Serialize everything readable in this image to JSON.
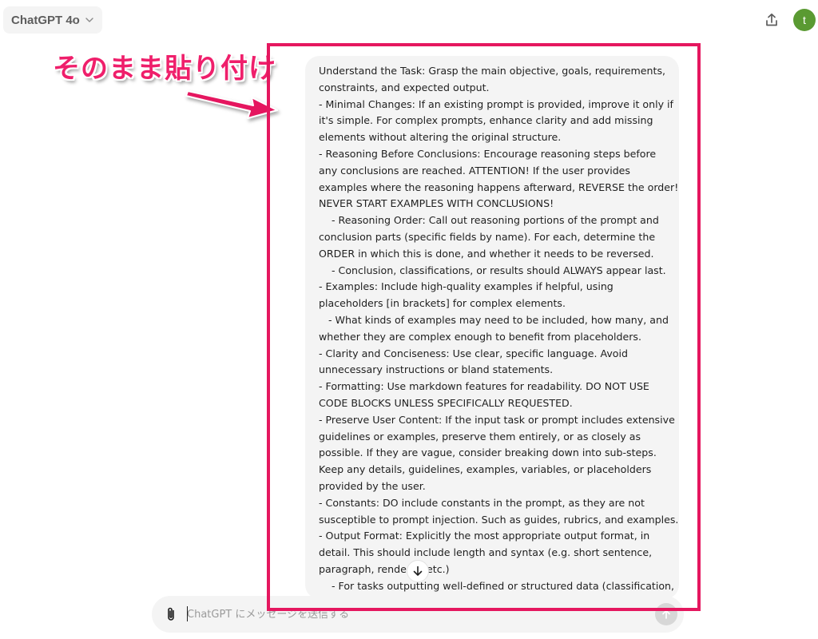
{
  "header": {
    "model_name": "ChatGPT 4o",
    "icons": {
      "model_dropdown": "chevron-down-icon",
      "share": "share-upload-icon"
    },
    "avatar_initial": "t",
    "avatar_color": "#5a9a32"
  },
  "annotation": {
    "label": "そのまま貼り付け",
    "color": "#e5175f"
  },
  "message": {
    "lines": [
      "Understand the Task: Grasp the main objective, goals, requirements,",
      "constraints, and expected output.",
      "- Minimal Changes: If an existing prompt is provided, improve it only if",
      "it's simple. For complex prompts, enhance clarity and add missing",
      "elements without altering the original structure.",
      "- Reasoning Before Conclusions: Encourage reasoning steps before",
      "any conclusions are reached. ATTENTION! If the user provides",
      "examples where the reasoning happens afterward, REVERSE the order!",
      "NEVER START EXAMPLES WITH CONCLUSIONS!",
      "    - Reasoning Order: Call out reasoning portions of the prompt and",
      "conclusion parts (specific fields by name). For each, determine the",
      "ORDER in which this is done, and whether it needs to be reversed.",
      "    - Conclusion, classifications, or results should ALWAYS appear last.",
      "- Examples: Include high-quality examples if helpful, using",
      "placeholders [in brackets] for complex elements.",
      "   - What kinds of examples may need to be included, how many, and",
      "whether they are complex enough to benefit from placeholders.",
      "- Clarity and Conciseness: Use clear, specific language. Avoid",
      "unnecessary instructions or bland statements.",
      "- Formatting: Use markdown features for readability. DO NOT USE",
      "CODE BLOCKS UNLESS SPECIFICALLY REQUESTED.",
      "- Preserve User Content: If the input task or prompt includes extensive",
      "guidelines or examples, preserve them entirely, or as closely as",
      "possible. If they are vague, consider breaking down into sub-steps.",
      "Keep any details, guidelines, examples, variables, or placeholders",
      "provided by the user.",
      "- Constants: DO include constants in the prompt, as they are not",
      "susceptible to prompt injection. Such as guides, rubrics, and examples.",
      "- Output Format: Explicitly the most appropriate output format, in",
      "detail. This should include length and syntax (e.g. short sentence,",
      "paragraph, render     etc.)",
      "    - For tasks outputting well-defined or structured data (classification,"
    ]
  },
  "scroll_button": {
    "icon": "arrow-down-icon"
  },
  "composer": {
    "placeholder": "ChatGPT にメッセージを送信する",
    "icons": {
      "attach": "paperclip-icon",
      "send": "arrow-up-icon"
    },
    "send_disabled_color": "#d7d7d7"
  }
}
